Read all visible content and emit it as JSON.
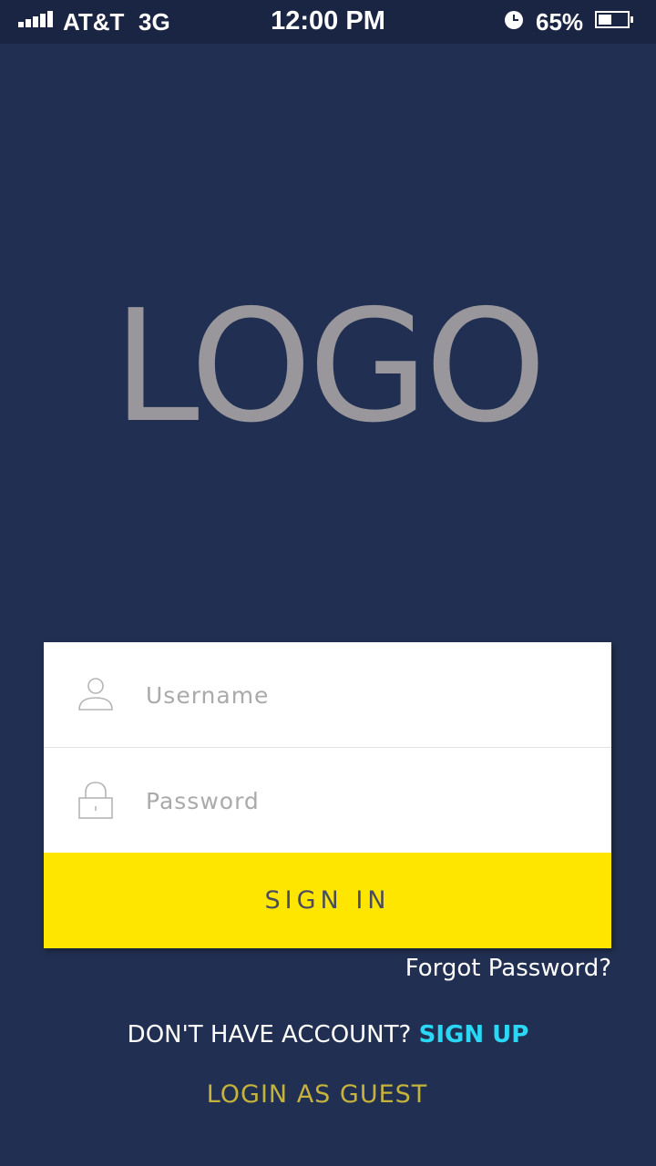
{
  "status_bar": {
    "carrier": "AT&T",
    "network": "3G",
    "time": "12:00 PM",
    "battery_percent_label": "65%",
    "battery_level": 0.65,
    "signal_icon": "signal-bars-icon",
    "alarm_icon": "alarm-clock-icon",
    "battery_icon": "battery-icon"
  },
  "logo": {
    "text": "LOGO"
  },
  "login_form": {
    "username": {
      "icon": "user-icon",
      "placeholder": "Username",
      "value": ""
    },
    "password": {
      "icon": "lock-icon",
      "placeholder": "Password",
      "value": ""
    },
    "sign_in_label": "SIGN IN"
  },
  "forgot_password": "Forgot Password?",
  "signup": {
    "prompt": "DON'T HAVE ACCOUNT?",
    "link": "SIGN UP"
  },
  "guest_login": "LOGIN AS GUEST",
  "colors": {
    "background": "#213052",
    "status_bar": "#1a2544",
    "logo": "#99979c",
    "sign_in_button": "#ffe600",
    "sign_up_link": "#2ad8f5",
    "guest_link": "#c6b33c"
  }
}
